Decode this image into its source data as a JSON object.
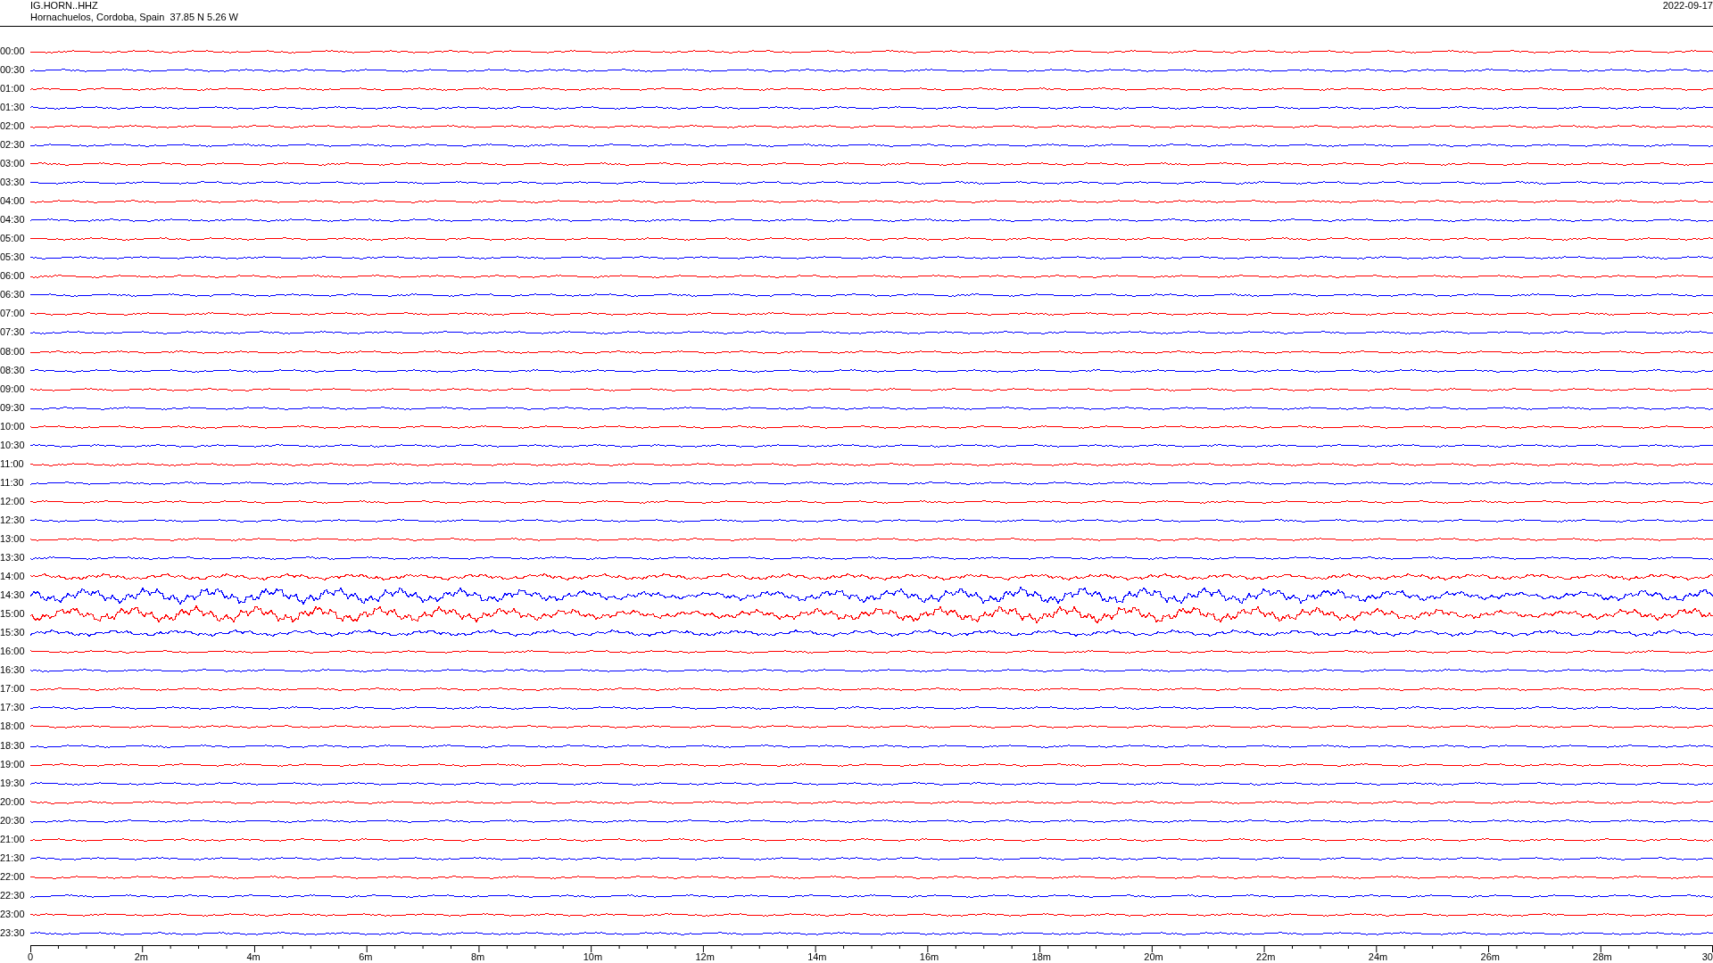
{
  "header": {
    "station": "IG.HORN..HHZ",
    "location": "Hornachuelos, Cordoba, Spain  37.85 N 5.26 W",
    "date": "2022-09-17"
  },
  "traces": [
    {
      "time": "00:00",
      "color": "#ff0000",
      "kind": "quiet"
    },
    {
      "time": "00:30",
      "color": "#0000ff",
      "kind": "quiet"
    },
    {
      "time": "01:00",
      "color": "#ff0000",
      "kind": "quiet"
    },
    {
      "time": "01:30",
      "color": "#0000ff",
      "kind": "quiet"
    },
    {
      "time": "02:00",
      "color": "#ff0000",
      "kind": "quiet"
    },
    {
      "time": "02:30",
      "color": "#0000ff",
      "kind": "quiet"
    },
    {
      "time": "03:00",
      "color": "#ff0000",
      "kind": "quiet"
    },
    {
      "time": "03:30",
      "color": "#0000ff",
      "kind": "quiet"
    },
    {
      "time": "04:00",
      "color": "#ff0000",
      "kind": "quiet"
    },
    {
      "time": "04:30",
      "color": "#0000ff",
      "kind": "quiet"
    },
    {
      "time": "05:00",
      "color": "#ff0000",
      "kind": "quiet"
    },
    {
      "time": "05:30",
      "color": "#0000ff",
      "kind": "quiet"
    },
    {
      "time": "06:00",
      "color": "#ff0000",
      "kind": "quiet"
    },
    {
      "time": "06:30",
      "color": "#0000ff",
      "kind": "quiet"
    },
    {
      "time": "07:00",
      "color": "#ff0000",
      "kind": "quiet"
    },
    {
      "time": "07:30",
      "color": "#0000ff",
      "kind": "quiet"
    },
    {
      "time": "08:00",
      "color": "#ff0000",
      "kind": "quiet"
    },
    {
      "time": "08:30",
      "color": "#0000ff",
      "kind": "quiet"
    },
    {
      "time": "09:00",
      "color": "#ff0000",
      "kind": "quiet"
    },
    {
      "time": "09:30",
      "color": "#0000ff",
      "kind": "quiet"
    },
    {
      "time": "10:00",
      "color": "#ff0000",
      "kind": "quiet"
    },
    {
      "time": "10:30",
      "color": "#0000ff",
      "kind": "quiet"
    },
    {
      "time": "11:00",
      "color": "#ff0000",
      "kind": "quiet"
    },
    {
      "time": "11:30",
      "color": "#0000ff",
      "kind": "quiet"
    },
    {
      "time": "12:00",
      "color": "#ff0000",
      "kind": "quiet"
    },
    {
      "time": "12:30",
      "color": "#0000ff",
      "kind": "quiet"
    },
    {
      "time": "13:00",
      "color": "#ff0000",
      "kind": "quiet"
    },
    {
      "time": "13:30",
      "color": "#0000ff",
      "kind": "quiet"
    },
    {
      "time": "14:00",
      "color": "#ff0000",
      "kind": "medium"
    },
    {
      "time": "14:30",
      "color": "#0000ff",
      "kind": "strong"
    },
    {
      "time": "15:00",
      "color": "#ff0000",
      "kind": "strong"
    },
    {
      "time": "15:30",
      "color": "#0000ff",
      "kind": "medium"
    },
    {
      "time": "16:00",
      "color": "#ff0000",
      "kind": "quiet"
    },
    {
      "time": "16:30",
      "color": "#0000ff",
      "kind": "quiet"
    },
    {
      "time": "17:00",
      "color": "#ff0000",
      "kind": "quiet"
    },
    {
      "time": "17:30",
      "color": "#0000ff",
      "kind": "quiet"
    },
    {
      "time": "18:00",
      "color": "#ff0000",
      "kind": "quiet"
    },
    {
      "time": "18:30",
      "color": "#0000ff",
      "kind": "quiet"
    },
    {
      "time": "19:00",
      "color": "#ff0000",
      "kind": "quiet"
    },
    {
      "time": "19:30",
      "color": "#0000ff",
      "kind": "quiet"
    },
    {
      "time": "20:00",
      "color": "#ff0000",
      "kind": "quiet"
    },
    {
      "time": "20:30",
      "color": "#0000ff",
      "kind": "quiet"
    },
    {
      "time": "21:00",
      "color": "#ff0000",
      "kind": "quiet"
    },
    {
      "time": "21:30",
      "color": "#0000ff",
      "kind": "quiet"
    },
    {
      "time": "22:00",
      "color": "#ff0000",
      "kind": "quiet"
    },
    {
      "time": "22:30",
      "color": "#0000ff",
      "kind": "quiet"
    },
    {
      "time": "23:00",
      "color": "#ff0000",
      "kind": "quiet"
    },
    {
      "time": "23:30",
      "color": "#0000ff",
      "kind": "quiet"
    }
  ],
  "axis": {
    "labels": [
      "0",
      "2m",
      "4m",
      "6m",
      "8m",
      "10m",
      "12m",
      "14m",
      "16m",
      "18m",
      "20m",
      "22m",
      "24m",
      "26m",
      "28m",
      "30"
    ]
  }
}
